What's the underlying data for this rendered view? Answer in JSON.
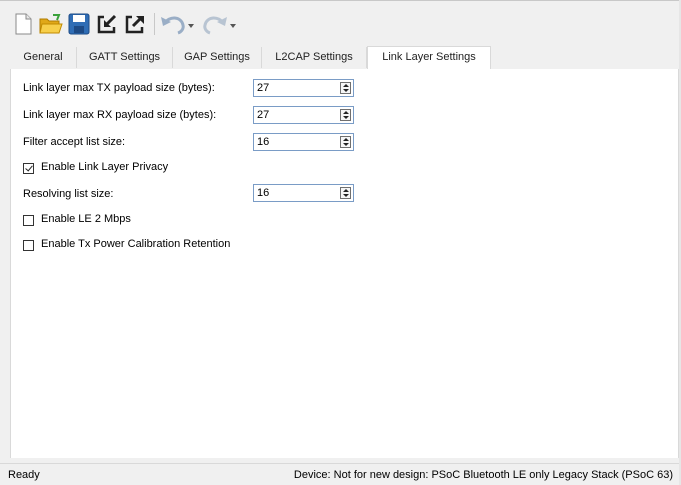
{
  "toolbar": {
    "buttons": [
      {
        "icon": "new-file-icon"
      },
      {
        "icon": "open-folder-icon"
      },
      {
        "icon": "save-icon"
      },
      {
        "icon": "import-icon"
      },
      {
        "icon": "export-icon"
      },
      {
        "icon": "undo-icon"
      },
      {
        "icon": "redo-icon"
      }
    ]
  },
  "tabs": [
    {
      "label": "General"
    },
    {
      "label": "GATT Settings"
    },
    {
      "label": "GAP Settings"
    },
    {
      "label": "L2CAP Settings"
    },
    {
      "label": "Link Layer Settings",
      "active": true
    }
  ],
  "settings": {
    "tx_payload": {
      "label": "Link layer max TX payload size (bytes):",
      "value": "27"
    },
    "rx_payload": {
      "label": "Link layer max RX payload size (bytes):",
      "value": "27"
    },
    "filter_accept": {
      "label": "Filter accept list size:",
      "value": "16"
    },
    "privacy": {
      "label": "Enable Link Layer Privacy",
      "checked": true
    },
    "resolving_list": {
      "label": "Resolving list size:",
      "value": "16"
    },
    "le2mbps": {
      "label": "Enable LE 2 Mbps",
      "checked": false
    },
    "tx_power": {
      "label": "Enable Tx Power Calibration Retention",
      "checked": false
    }
  },
  "status": {
    "left": "Ready",
    "right": "Device: Not for new design: PSoC Bluetooth LE only Legacy Stack (PSoC 63)"
  },
  "colors": {
    "folder": "#f2c230",
    "save": "#2f6db5",
    "arrow": "#222222",
    "spin_border": "#7a9cc6"
  }
}
